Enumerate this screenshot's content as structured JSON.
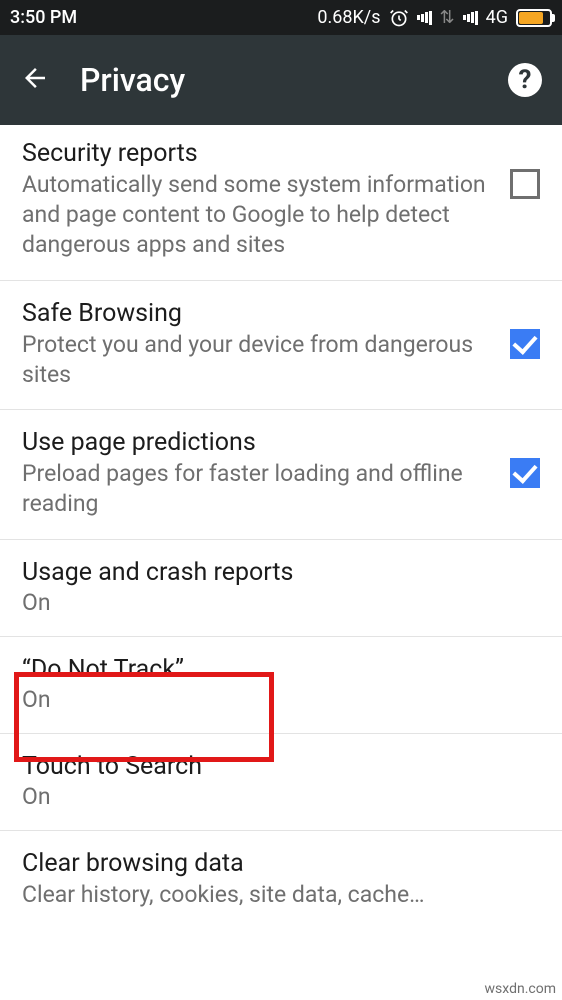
{
  "status": {
    "time": "3:50 PM",
    "speed": "0.68K/s",
    "network": "4G"
  },
  "header": {
    "title": "Privacy"
  },
  "rows": {
    "security_reports": {
      "title": "Security reports",
      "desc": "Automatically send some system information and page content to Google to help detect dangerous apps and sites"
    },
    "safe_browsing": {
      "title": "Safe Browsing",
      "desc": "Protect you and your device from dangerous sites"
    },
    "page_predictions": {
      "title": "Use page predictions",
      "desc": "Preload pages for faster loading and offline reading"
    },
    "usage_reports": {
      "title": "Usage and crash reports",
      "value": "On"
    },
    "do_not_track": {
      "title": "“Do Not Track”",
      "value": "On"
    },
    "touch_search": {
      "title": "Touch to Search",
      "value": "On"
    },
    "clear_data": {
      "title": "Clear browsing data",
      "desc": "Clear history, cookies, site data, cache…"
    }
  },
  "watermark": "wsxdn.com"
}
